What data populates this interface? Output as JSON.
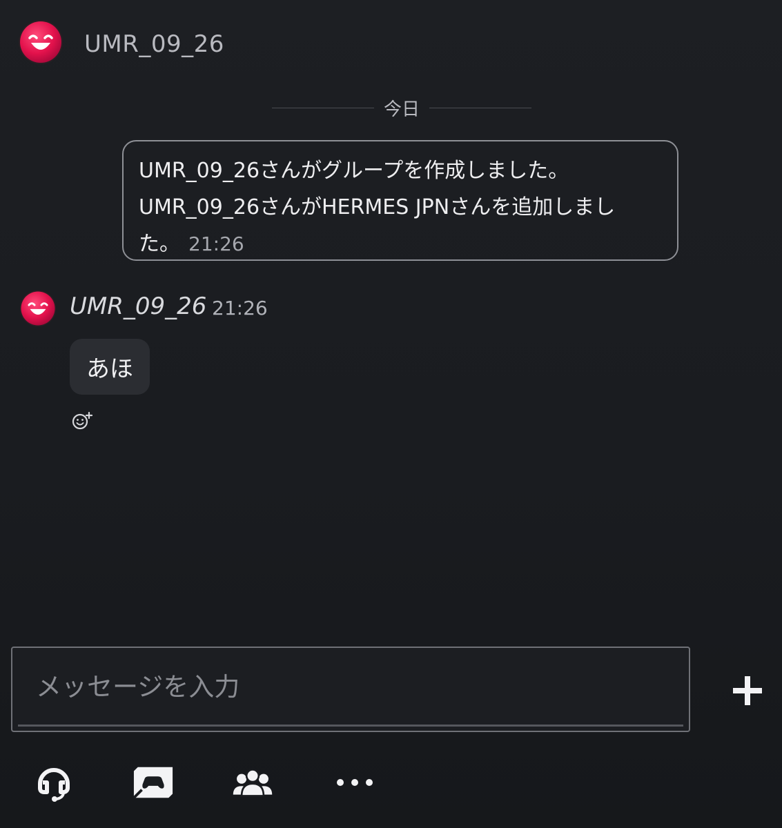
{
  "header": {
    "name": "UMR_09_26"
  },
  "divider": {
    "date_label": "今日"
  },
  "system_message": {
    "line1": "UMR_09_26さんがグループを作成しました。",
    "line2": "UMR_09_26さんがHERMES JPNさんを追加しまし",
    "line3": "た。",
    "time": "21:26"
  },
  "message": {
    "sender": "UMR_09_26",
    "time": "21:26",
    "text": "あほ"
  },
  "composer": {
    "placeholder": "メッセージを入力"
  },
  "icons": {
    "avatar": "smiling-face-avatar-icon",
    "reaction": "add-reaction-icon",
    "plus": "plus-icon",
    "voice": "headset-icon",
    "share": "share-screen-icon",
    "members": "group-members-icon",
    "more": "more-options-icon"
  },
  "colors": {
    "avatar": "#e8134f",
    "background": "#1b1d21",
    "bubble": "#2b2d32"
  }
}
